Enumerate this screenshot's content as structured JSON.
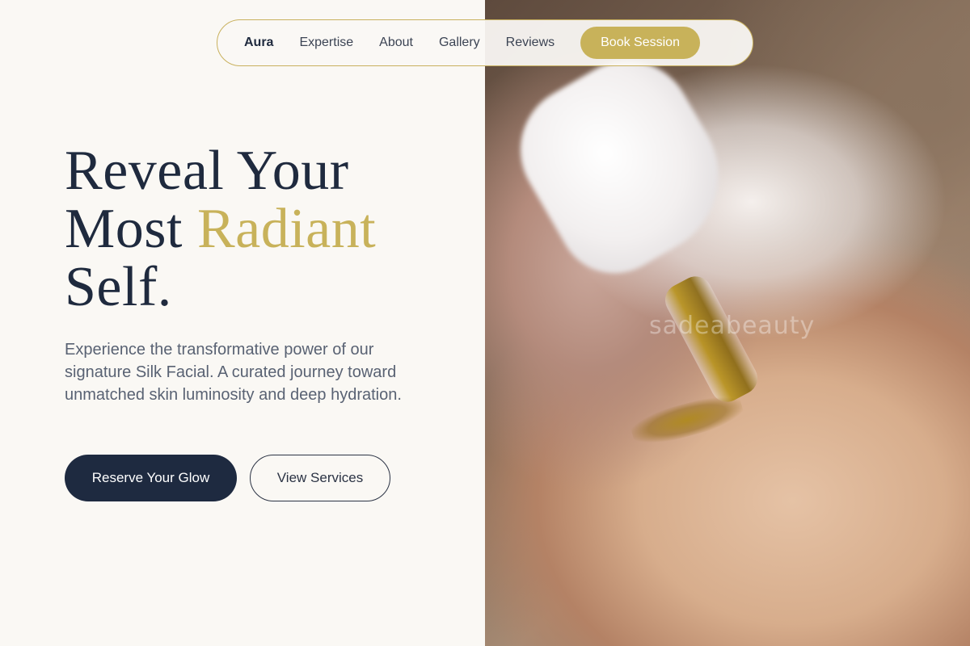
{
  "nav": {
    "brand": "Aura",
    "links": [
      "Expertise",
      "About",
      "Gallery",
      "Reviews"
    ],
    "cta": "Book Session"
  },
  "hero": {
    "title_line1": "Reveal Your",
    "title_line2_prefix": "Most ",
    "title_accent": "Radiant",
    "title_line3": "Self.",
    "lede": "Experience the transformative power of our signature Silk Facial. A curated journey toward unmatched skin luminosity and deep hydration.",
    "primary_cta": "Reserve Your Glow",
    "secondary_cta": "View Services"
  },
  "image": {
    "watermark": "sadeabeauty"
  },
  "colors": {
    "navy": "#1e2a40",
    "gold": "#c8b25a",
    "cream": "#faf8f4"
  }
}
